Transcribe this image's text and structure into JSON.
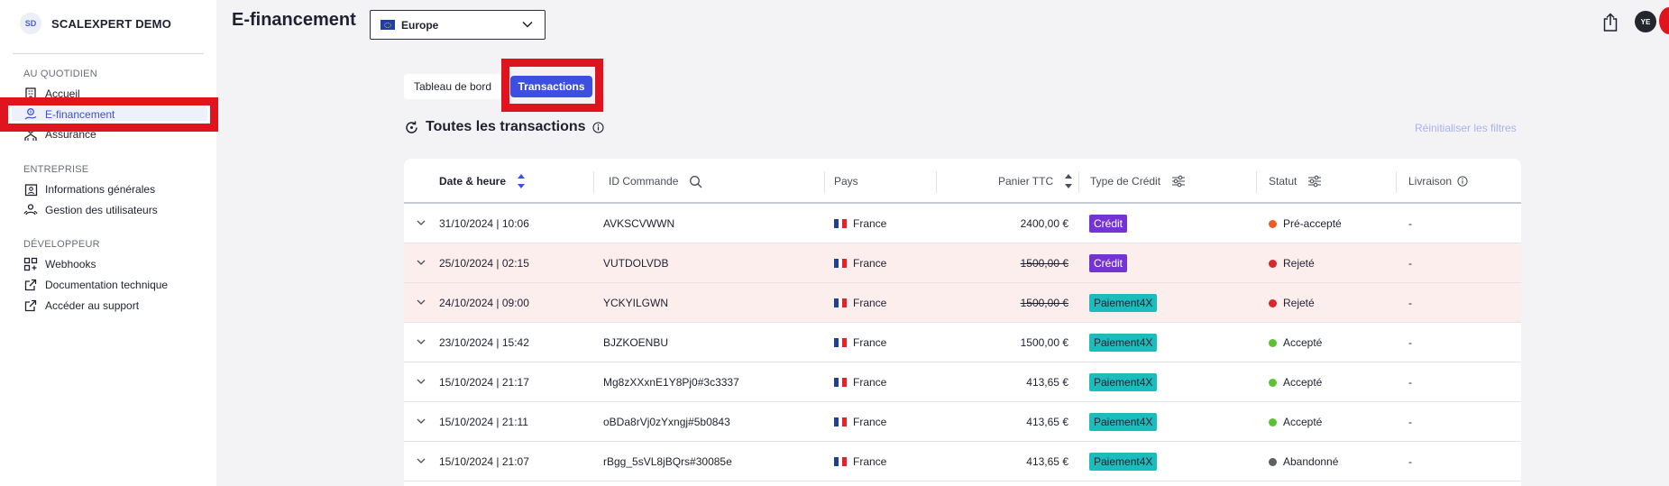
{
  "sidebar": {
    "brand_initials": "SD",
    "brand_name": "SCALEXPERT DEMO",
    "sections": [
      {
        "label": "AU QUOTIDIEN"
      },
      {
        "label": "ENTREPRISE"
      },
      {
        "label": "DÉVELOPPEUR"
      }
    ],
    "items": [
      {
        "label": "Accueil",
        "icon": "building-icon"
      },
      {
        "label": "E-financement",
        "icon": "financing-icon",
        "active": true
      },
      {
        "label": "Assurance",
        "icon": "insurance-icon"
      },
      {
        "label": "Informations générales",
        "icon": "company-info-icon"
      },
      {
        "label": "Gestion des utilisateurs",
        "icon": "users-icon"
      },
      {
        "label": "Webhooks",
        "icon": "webhooks-icon"
      },
      {
        "label": "Documentation technique",
        "icon": "external-link-icon"
      },
      {
        "label": "Accéder au support",
        "icon": "external-link-icon"
      }
    ]
  },
  "header": {
    "title": "E-financement",
    "region": "Europe",
    "avatar_initials": "YE"
  },
  "tabs": [
    {
      "label": "Tableau de bord",
      "active": false
    },
    {
      "label": "Transactions",
      "active": true
    }
  ],
  "list": {
    "title": "Toutes les transactions",
    "reset_label": "Réinitialiser les filtres"
  },
  "table": {
    "columns": [
      "Date & heure",
      "ID Commande",
      "Pays",
      "Panier TTC",
      "Type de Crédit",
      "Statut",
      "Livraison"
    ],
    "rows": [
      {
        "date": "31/10/2024 | 10:06",
        "order_id": "AVKSCVWWN",
        "country": "France",
        "amount": "2400,00 €",
        "credit_type": "Crédit",
        "status": "Pré-accepté",
        "delivery": "-"
      },
      {
        "date": "25/10/2024 | 02:15",
        "order_id": "VUTDOLVDB",
        "country": "France",
        "amount": "1500,00 €",
        "credit_type": "Crédit",
        "status": "Rejeté",
        "delivery": "-"
      },
      {
        "date": "24/10/2024 | 09:00",
        "order_id": "YCKYILGWN",
        "country": "France",
        "amount": "1500,00 €",
        "credit_type": "Paiement4X",
        "status": "Rejeté",
        "delivery": "-"
      },
      {
        "date": "23/10/2024 | 15:42",
        "order_id": "BJZKOENBU",
        "country": "France",
        "amount": "1500,00 €",
        "credit_type": "Paiement4X",
        "status": "Accepté",
        "delivery": "-"
      },
      {
        "date": "15/10/2024 | 21:17",
        "order_id": "Mg8zXXxnE1Y8Pj0#3c3337",
        "country": "France",
        "amount": "413,65 €",
        "credit_type": "Paiement4X",
        "status": "Accepté",
        "delivery": "-"
      },
      {
        "date": "15/10/2024 | 21:11",
        "order_id": "oBDa8rVj0zYxngj#5b0843",
        "country": "France",
        "amount": "413,65 €",
        "credit_type": "Paiement4X",
        "status": "Accepté",
        "delivery": "-"
      },
      {
        "date": "15/10/2024 | 21:07",
        "order_id": "rBgg_5sVL8jBQrs#30085e",
        "country": "France",
        "amount": "413,65 €",
        "credit_type": "Paiement4X",
        "status": "Abandonné",
        "delivery": "-"
      }
    ]
  },
  "colors": {
    "accent": "#3c4fe0",
    "highlight_box": "#e0141e",
    "credit_badge": "#7434d4",
    "paiement4x_badge": "#1cbcbc",
    "status_pre_accepted": "#f05a28",
    "status_rejected": "#e0242b",
    "status_accepted": "#5bc236",
    "status_abandoned": "#5c5f66",
    "rejected_row_bg": "#fdeeee"
  }
}
